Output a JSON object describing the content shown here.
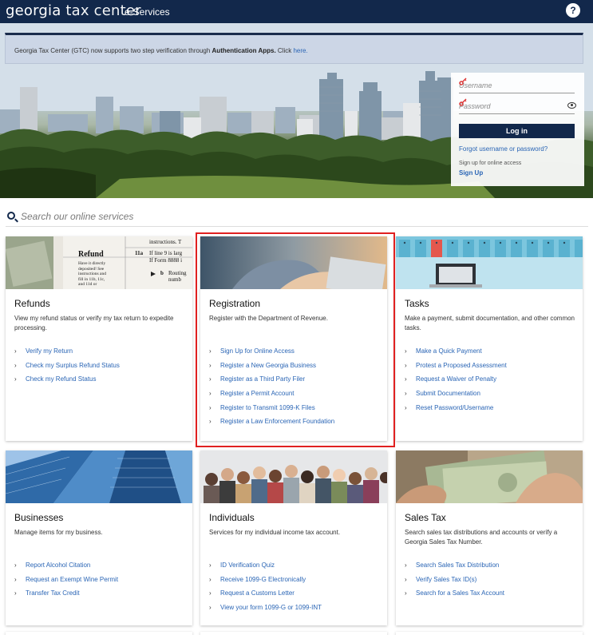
{
  "header": {
    "logo_bold": "georgia",
    "logo_light": "tax center",
    "subtitle": "e-Services",
    "help_label": "?"
  },
  "notice": {
    "text": "Georgia Tax Center (GTC) now supports two step verification through ",
    "bold": "Authentication Apps.",
    "click": "  Click ",
    "link": "here."
  },
  "login": {
    "username_placeholder": "Username",
    "password_placeholder": "Password",
    "login_label": "Log in",
    "forgot_label": "Forgot username or password?",
    "signup_note": "Sign up for online access",
    "signup_label": "Sign Up"
  },
  "search": {
    "placeholder": "Search our online services"
  },
  "cards": [
    {
      "title": "Refunds",
      "description": "View my refund status or verify my tax return to expedite processing.",
      "image_text": [
        "Refund",
        "Have it directly",
        "deposited! See",
        "instructions and",
        "fill in 11b, 11c,",
        "and 11d or",
        "11a",
        "If line 9 is larg",
        "If Form 8888 i",
        "b",
        "Routing numb",
        "instructions. T"
      ],
      "links": [
        "Verify my Return",
        "Check my Surplus Refund Status",
        "Check my Refund Status"
      ]
    },
    {
      "title": "Registration",
      "description": "Register with the Department of Revenue.",
      "links": [
        "Sign Up for Online Access",
        "Register a New Georgia Business",
        "Register as a Third Party Filer",
        "Register a Permit Account",
        "Register to Transmit 1099-K Files",
        "Register a Law Enforcement Foundation"
      ]
    },
    {
      "title": "Tasks",
      "description": "Make a payment, submit documentation, and other common tasks.",
      "links": [
        "Make a Quick Payment",
        "Protest a Proposed Assessment",
        "Request a Waiver of Penalty",
        "Submit Documentation",
        "Reset Password/Username"
      ]
    },
    {
      "title": "Businesses",
      "description": "Manage items for my business.",
      "links": [
        "Report Alcohol Citation",
        "Request an Exempt Wine Permit",
        "Transfer Tax Credit"
      ]
    },
    {
      "title": "Individuals",
      "description": "Services for my individual income tax account.",
      "links": [
        "ID Verification Quiz",
        "Receive 1099-G Electronically",
        "Request a Customs Letter",
        "View your form 1099-G or 1099-INT"
      ]
    },
    {
      "title": "Sales Tax",
      "description": "Search sales tax distributions and accounts or verify a Georgia Sales Tax Number.",
      "links": [
        "Search Sales Tax Distribution",
        "Verify Sales Tax ID(s)",
        "Search for a Sales Tax Account"
      ]
    }
  ],
  "colors": {
    "navy": "#12284b",
    "link": "#2a65b5",
    "highlight": "#e02020",
    "notice_bg": "#ccd6e6"
  }
}
